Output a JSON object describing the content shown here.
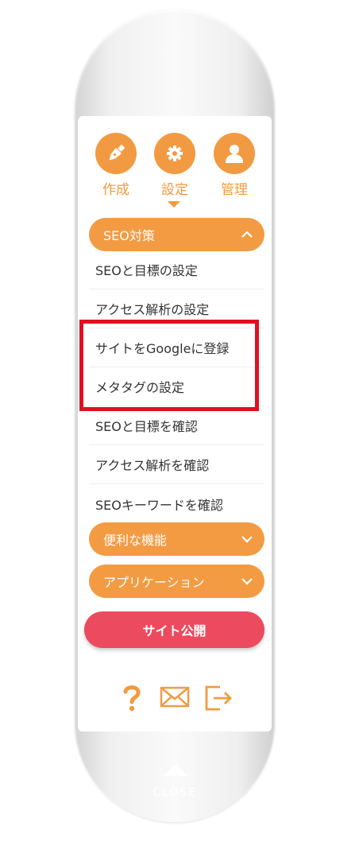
{
  "top_nav": [
    {
      "label": "作成",
      "icon": "pen-nib-icon"
    },
    {
      "label": "設定",
      "icon": "gear-icon"
    },
    {
      "label": "管理",
      "icon": "user-icon"
    }
  ],
  "sections": {
    "seo": {
      "label": "SEO対策",
      "state": "expanded"
    },
    "useful": {
      "label": "便利な機能",
      "state": "collapsed"
    },
    "apps": {
      "label": "アプリケーション",
      "state": "collapsed"
    }
  },
  "seo_items": [
    "SEOと目標の設定",
    "アクセス解析の設定",
    "サイトをGoogleに登録",
    "メタタグの設定",
    "SEOと目標を確認",
    "アクセス解析を確認",
    "SEOキーワードを確認"
  ],
  "publish_button": "サイト公開",
  "bottom_icons": [
    "help-icon",
    "mail-icon",
    "logout-icon"
  ],
  "close_label": "CLOSE",
  "colors": {
    "accent": "#f29a41",
    "publish": "#ec4a5e",
    "highlight": "#e0101f"
  }
}
